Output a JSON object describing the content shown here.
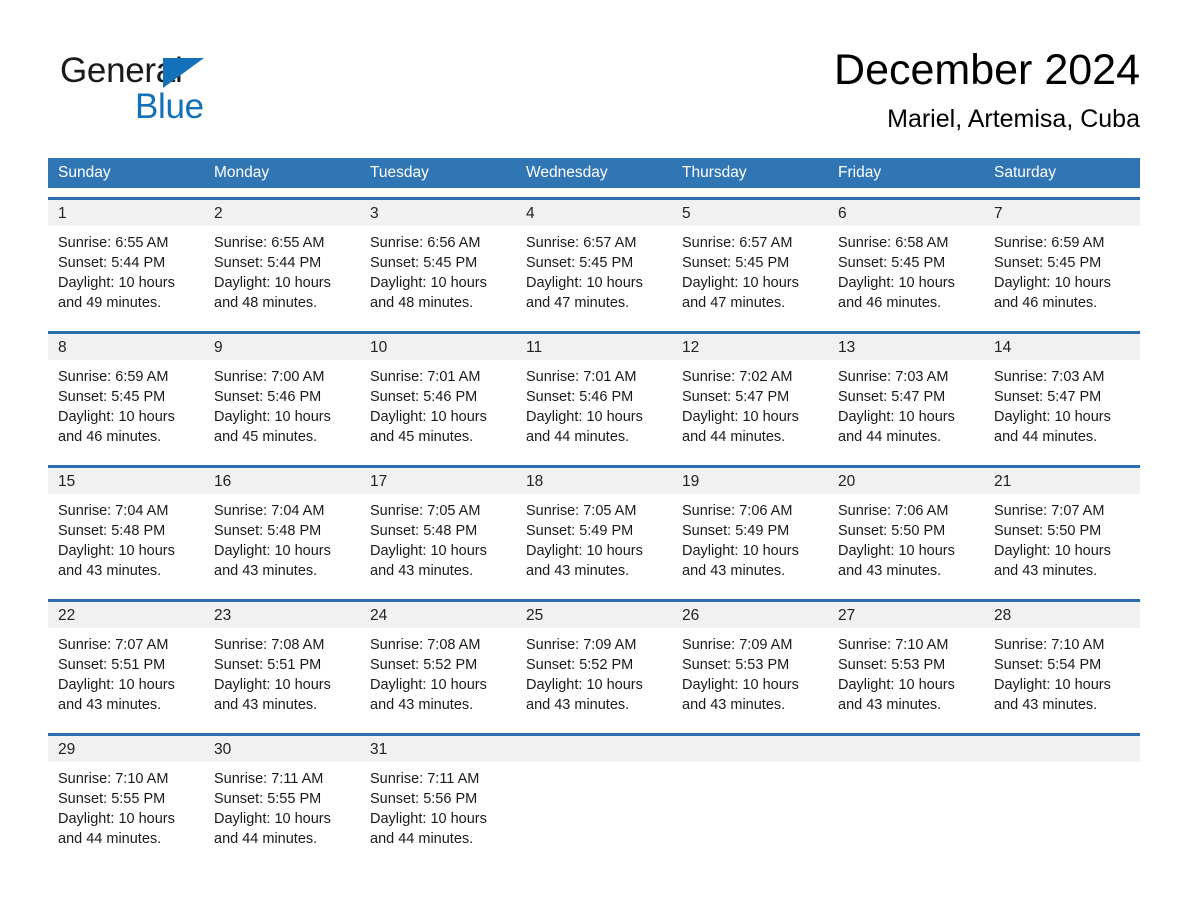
{
  "brand": {
    "name_dark": "General",
    "name_blue": "Blue",
    "logo_icon": "triangle-icon",
    "accent_color": "#1271b8"
  },
  "header": {
    "title": "December 2024",
    "subtitle": "Mariel, Artemisa, Cuba"
  },
  "calendar": {
    "header_bg": "#3076b5",
    "row_border": "#2d6fae",
    "daynum_bg": "#f1f1f1",
    "weekdays": [
      "Sunday",
      "Monday",
      "Tuesday",
      "Wednesday",
      "Thursday",
      "Friday",
      "Saturday"
    ],
    "weeks": [
      [
        {
          "day": "1",
          "sunrise": "Sunrise: 6:55 AM",
          "sunset": "Sunset: 5:44 PM",
          "daylight1": "Daylight: 10 hours",
          "daylight2": "and 49 minutes."
        },
        {
          "day": "2",
          "sunrise": "Sunrise: 6:55 AM",
          "sunset": "Sunset: 5:44 PM",
          "daylight1": "Daylight: 10 hours",
          "daylight2": "and 48 minutes."
        },
        {
          "day": "3",
          "sunrise": "Sunrise: 6:56 AM",
          "sunset": "Sunset: 5:45 PM",
          "daylight1": "Daylight: 10 hours",
          "daylight2": "and 48 minutes."
        },
        {
          "day": "4",
          "sunrise": "Sunrise: 6:57 AM",
          "sunset": "Sunset: 5:45 PM",
          "daylight1": "Daylight: 10 hours",
          "daylight2": "and 47 minutes."
        },
        {
          "day": "5",
          "sunrise": "Sunrise: 6:57 AM",
          "sunset": "Sunset: 5:45 PM",
          "daylight1": "Daylight: 10 hours",
          "daylight2": "and 47 minutes."
        },
        {
          "day": "6",
          "sunrise": "Sunrise: 6:58 AM",
          "sunset": "Sunset: 5:45 PM",
          "daylight1": "Daylight: 10 hours",
          "daylight2": "and 46 minutes."
        },
        {
          "day": "7",
          "sunrise": "Sunrise: 6:59 AM",
          "sunset": "Sunset: 5:45 PM",
          "daylight1": "Daylight: 10 hours",
          "daylight2": "and 46 minutes."
        }
      ],
      [
        {
          "day": "8",
          "sunrise": "Sunrise: 6:59 AM",
          "sunset": "Sunset: 5:45 PM",
          "daylight1": "Daylight: 10 hours",
          "daylight2": "and 46 minutes."
        },
        {
          "day": "9",
          "sunrise": "Sunrise: 7:00 AM",
          "sunset": "Sunset: 5:46 PM",
          "daylight1": "Daylight: 10 hours",
          "daylight2": "and 45 minutes."
        },
        {
          "day": "10",
          "sunrise": "Sunrise: 7:01 AM",
          "sunset": "Sunset: 5:46 PM",
          "daylight1": "Daylight: 10 hours",
          "daylight2": "and 45 minutes."
        },
        {
          "day": "11",
          "sunrise": "Sunrise: 7:01 AM",
          "sunset": "Sunset: 5:46 PM",
          "daylight1": "Daylight: 10 hours",
          "daylight2": "and 44 minutes."
        },
        {
          "day": "12",
          "sunrise": "Sunrise: 7:02 AM",
          "sunset": "Sunset: 5:47 PM",
          "daylight1": "Daylight: 10 hours",
          "daylight2": "and 44 minutes."
        },
        {
          "day": "13",
          "sunrise": "Sunrise: 7:03 AM",
          "sunset": "Sunset: 5:47 PM",
          "daylight1": "Daylight: 10 hours",
          "daylight2": "and 44 minutes."
        },
        {
          "day": "14",
          "sunrise": "Sunrise: 7:03 AM",
          "sunset": "Sunset: 5:47 PM",
          "daylight1": "Daylight: 10 hours",
          "daylight2": "and 44 minutes."
        }
      ],
      [
        {
          "day": "15",
          "sunrise": "Sunrise: 7:04 AM",
          "sunset": "Sunset: 5:48 PM",
          "daylight1": "Daylight: 10 hours",
          "daylight2": "and 43 minutes."
        },
        {
          "day": "16",
          "sunrise": "Sunrise: 7:04 AM",
          "sunset": "Sunset: 5:48 PM",
          "daylight1": "Daylight: 10 hours",
          "daylight2": "and 43 minutes."
        },
        {
          "day": "17",
          "sunrise": "Sunrise: 7:05 AM",
          "sunset": "Sunset: 5:48 PM",
          "daylight1": "Daylight: 10 hours",
          "daylight2": "and 43 minutes."
        },
        {
          "day": "18",
          "sunrise": "Sunrise: 7:05 AM",
          "sunset": "Sunset: 5:49 PM",
          "daylight1": "Daylight: 10 hours",
          "daylight2": "and 43 minutes."
        },
        {
          "day": "19",
          "sunrise": "Sunrise: 7:06 AM",
          "sunset": "Sunset: 5:49 PM",
          "daylight1": "Daylight: 10 hours",
          "daylight2": "and 43 minutes."
        },
        {
          "day": "20",
          "sunrise": "Sunrise: 7:06 AM",
          "sunset": "Sunset: 5:50 PM",
          "daylight1": "Daylight: 10 hours",
          "daylight2": "and 43 minutes."
        },
        {
          "day": "21",
          "sunrise": "Sunrise: 7:07 AM",
          "sunset": "Sunset: 5:50 PM",
          "daylight1": "Daylight: 10 hours",
          "daylight2": "and 43 minutes."
        }
      ],
      [
        {
          "day": "22",
          "sunrise": "Sunrise: 7:07 AM",
          "sunset": "Sunset: 5:51 PM",
          "daylight1": "Daylight: 10 hours",
          "daylight2": "and 43 minutes."
        },
        {
          "day": "23",
          "sunrise": "Sunrise: 7:08 AM",
          "sunset": "Sunset: 5:51 PM",
          "daylight1": "Daylight: 10 hours",
          "daylight2": "and 43 minutes."
        },
        {
          "day": "24",
          "sunrise": "Sunrise: 7:08 AM",
          "sunset": "Sunset: 5:52 PM",
          "daylight1": "Daylight: 10 hours",
          "daylight2": "and 43 minutes."
        },
        {
          "day": "25",
          "sunrise": "Sunrise: 7:09 AM",
          "sunset": "Sunset: 5:52 PM",
          "daylight1": "Daylight: 10 hours",
          "daylight2": "and 43 minutes."
        },
        {
          "day": "26",
          "sunrise": "Sunrise: 7:09 AM",
          "sunset": "Sunset: 5:53 PM",
          "daylight1": "Daylight: 10 hours",
          "daylight2": "and 43 minutes."
        },
        {
          "day": "27",
          "sunrise": "Sunrise: 7:10 AM",
          "sunset": "Sunset: 5:53 PM",
          "daylight1": "Daylight: 10 hours",
          "daylight2": "and 43 minutes."
        },
        {
          "day": "28",
          "sunrise": "Sunrise: 7:10 AM",
          "sunset": "Sunset: 5:54 PM",
          "daylight1": "Daylight: 10 hours",
          "daylight2": "and 43 minutes."
        }
      ],
      [
        {
          "day": "29",
          "sunrise": "Sunrise: 7:10 AM",
          "sunset": "Sunset: 5:55 PM",
          "daylight1": "Daylight: 10 hours",
          "daylight2": "and 44 minutes."
        },
        {
          "day": "30",
          "sunrise": "Sunrise: 7:11 AM",
          "sunset": "Sunset: 5:55 PM",
          "daylight1": "Daylight: 10 hours",
          "daylight2": "and 44 minutes."
        },
        {
          "day": "31",
          "sunrise": "Sunrise: 7:11 AM",
          "sunset": "Sunset: 5:56 PM",
          "daylight1": "Daylight: 10 hours",
          "daylight2": "and 44 minutes."
        },
        {
          "day": "",
          "sunrise": "",
          "sunset": "",
          "daylight1": "",
          "daylight2": ""
        },
        {
          "day": "",
          "sunrise": "",
          "sunset": "",
          "daylight1": "",
          "daylight2": ""
        },
        {
          "day": "",
          "sunrise": "",
          "sunset": "",
          "daylight1": "",
          "daylight2": ""
        },
        {
          "day": "",
          "sunrise": "",
          "sunset": "",
          "daylight1": "",
          "daylight2": ""
        }
      ]
    ]
  }
}
